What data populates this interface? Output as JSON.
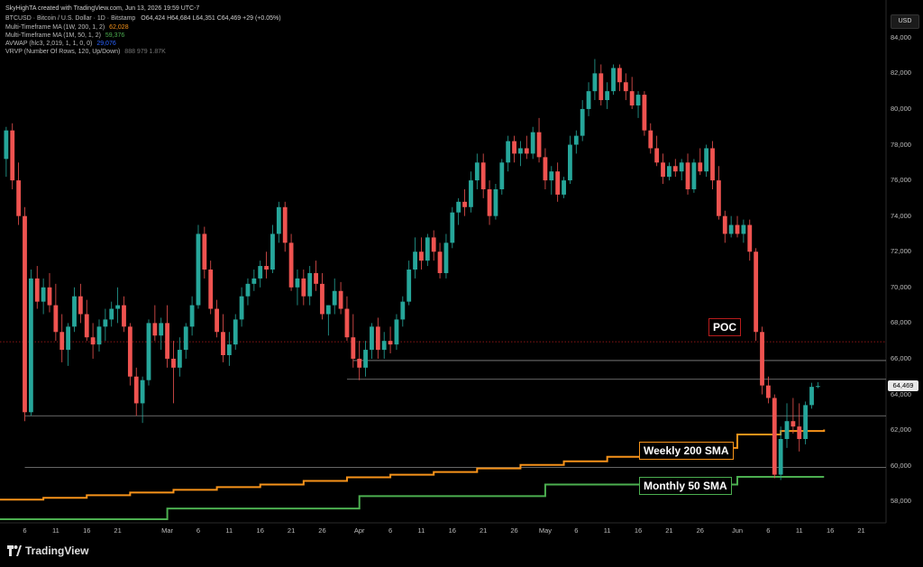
{
  "header": {
    "credit": "SkyHighTA created with TradingView.com, Jun 13, 2026 19:59 UTC-7",
    "symbol_line": "BTCUSD · Bitcoin / U.S. Dollar · 1D · Bitstamp",
    "ohlc": "O64,424 H64,684 L64,351 C64,469 +29 (+0.05%)",
    "indicators": [
      {
        "label": "Multi-Timeframe MA (1W, 200, 1, 2)",
        "value": "62,028",
        "color": "#f7931a"
      },
      {
        "label": "Multi-Timeframe MA (1M, 50, 1, 2)",
        "value": "59,376",
        "color": "#4caf50"
      },
      {
        "label": "AVWAP (hlc3, 2,019, 1, 1, 0, 0)",
        "value": "29,076",
        "color": "#2962ff"
      },
      {
        "label": "VRVP (Number Of Rows, 120, Up/Down)",
        "value": "888  979  1.87K",
        "color": "#888888"
      }
    ]
  },
  "currency_button": "USD",
  "current_price": "64,469",
  "brand": "TradingView",
  "colors": {
    "up": "#26a69a",
    "down": "#ef5350",
    "weekly": "#f7931a",
    "monthly": "#4caf50",
    "poc": "#b71c1c"
  },
  "annotations": {
    "poc": "POC",
    "weekly": "Weekly 200 SMA",
    "monthly": "Monthly 50 SMA"
  },
  "chart_data": {
    "type": "candlestick",
    "title": "BTCUSD · Bitcoin / U.S. Dollar · 1D · Bitstamp",
    "y_ticks": [
      "84,000",
      "82,000",
      "80,000",
      "78,000",
      "76,000",
      "74,000",
      "72,000",
      "70,000",
      "68,000",
      "66,000",
      "64,000",
      "62,000",
      "60,000",
      "58,000"
    ],
    "ylim": [
      56800,
      85000
    ],
    "x_ticks": [
      {
        "label": "6",
        "date": "2026-02-06"
      },
      {
        "label": "11",
        "date": "2026-02-11"
      },
      {
        "label": "16",
        "date": "2026-02-16"
      },
      {
        "label": "21",
        "date": "2026-02-21"
      },
      {
        "label": "Mar",
        "date": "2026-03-01"
      },
      {
        "label": "6",
        "date": "2026-03-06"
      },
      {
        "label": "11",
        "date": "2026-03-11"
      },
      {
        "label": "16",
        "date": "2026-03-16"
      },
      {
        "label": "21",
        "date": "2026-03-21"
      },
      {
        "label": "26",
        "date": "2026-03-26"
      },
      {
        "label": "Apr",
        "date": "2026-04-01"
      },
      {
        "label": "6",
        "date": "2026-04-06"
      },
      {
        "label": "11",
        "date": "2026-04-11"
      },
      {
        "label": "16",
        "date": "2026-04-16"
      },
      {
        "label": "21",
        "date": "2026-04-21"
      },
      {
        "label": "26",
        "date": "2026-04-26"
      },
      {
        "label": "May",
        "date": "2026-05-01"
      },
      {
        "label": "6",
        "date": "2026-05-06"
      },
      {
        "label": "11",
        "date": "2026-05-11"
      },
      {
        "label": "16",
        "date": "2026-05-16"
      },
      {
        "label": "21",
        "date": "2026-05-21"
      },
      {
        "label": "26",
        "date": "2026-05-26"
      },
      {
        "label": "Jun",
        "date": "2026-06-01"
      },
      {
        "label": "6",
        "date": "2026-06-06"
      },
      {
        "label": "11",
        "date": "2026-06-11"
      },
      {
        "label": "16",
        "date": "2026-06-16"
      },
      {
        "label": "21",
        "date": "2026-06-21"
      }
    ],
    "xlim": [
      "2026-02-02",
      "2026-06-25"
    ],
    "candles": [
      [
        "2026-02-03",
        77200,
        79000,
        76200,
        78800
      ],
      [
        "2026-02-04",
        78800,
        79200,
        75500,
        76000
      ],
      [
        "2026-02-05",
        76000,
        77000,
        73500,
        74000
      ],
      [
        "2026-02-06",
        74000,
        74500,
        62500,
        63000
      ],
      [
        "2026-02-07",
        63000,
        71000,
        62800,
        70500
      ],
      [
        "2026-02-08",
        70500,
        71200,
        68800,
        69200
      ],
      [
        "2026-02-09",
        69200,
        70500,
        68500,
        70000
      ],
      [
        "2026-02-10",
        70000,
        70800,
        68600,
        69000
      ],
      [
        "2026-02-11",
        69000,
        70200,
        67000,
        67500
      ],
      [
        "2026-02-12",
        67500,
        68500,
        65800,
        66500
      ],
      [
        "2026-02-13",
        66500,
        68000,
        65600,
        67800
      ],
      [
        "2026-02-14",
        67800,
        70000,
        67500,
        69500
      ],
      [
        "2026-02-15",
        69500,
        70200,
        68000,
        68500
      ],
      [
        "2026-02-16",
        68500,
        69300,
        67000,
        67200
      ],
      [
        "2026-02-17",
        67200,
        68000,
        66000,
        66800
      ],
      [
        "2026-02-18",
        66800,
        68200,
        66400,
        67800
      ],
      [
        "2026-02-19",
        67800,
        68800,
        67000,
        68200
      ],
      [
        "2026-02-20",
        68200,
        69200,
        67800,
        68800
      ],
      [
        "2026-02-21",
        68800,
        70000,
        68000,
        69000
      ],
      [
        "2026-02-22",
        69000,
        69500,
        67500,
        67800
      ],
      [
        "2026-02-23",
        67800,
        68000,
        64500,
        65000
      ],
      [
        "2026-02-24",
        65000,
        65500,
        62800,
        63500
      ],
      [
        "2026-02-25",
        63500,
        65000,
        62400,
        64800
      ],
      [
        "2026-02-26",
        64800,
        68200,
        64500,
        68000
      ],
      [
        "2026-02-27",
        68000,
        69000,
        67000,
        67300
      ],
      [
        "2026-02-28",
        67300,
        68300,
        66500,
        68000
      ],
      [
        "2026-03-01",
        68000,
        69000,
        65500,
        66000
      ],
      [
        "2026-03-02",
        66000,
        67000,
        63500,
        65500
      ],
      [
        "2026-03-03",
        65500,
        67200,
        65000,
        66500
      ],
      [
        "2026-03-04",
        66500,
        68000,
        66000,
        67800
      ],
      [
        "2026-03-05",
        67800,
        69500,
        67300,
        69000
      ],
      [
        "2026-03-06",
        69000,
        73500,
        68800,
        73000
      ],
      [
        "2026-03-07",
        73000,
        73400,
        70500,
        71000
      ],
      [
        "2026-03-08",
        71000,
        71500,
        68500,
        68800
      ],
      [
        "2026-03-09",
        68800,
        69300,
        67200,
        67500
      ],
      [
        "2026-03-10",
        67500,
        68500,
        65800,
        66200
      ],
      [
        "2026-03-11",
        66200,
        67500,
        65600,
        66800
      ],
      [
        "2026-03-12",
        66800,
        68500,
        66500,
        68200
      ],
      [
        "2026-03-13",
        68200,
        70000,
        67800,
        69500
      ],
      [
        "2026-03-14",
        69500,
        70500,
        69000,
        70200
      ],
      [
        "2026-03-15",
        70200,
        71000,
        69800,
        70500
      ],
      [
        "2026-03-16",
        70500,
        71500,
        70000,
        71200
      ],
      [
        "2026-03-17",
        71200,
        72000,
        70500,
        71000
      ],
      [
        "2026-03-18",
        71000,
        73500,
        70800,
        73000
      ],
      [
        "2026-03-19",
        73000,
        74800,
        72500,
        74500
      ],
      [
        "2026-03-20",
        74500,
        74800,
        72000,
        72500
      ],
      [
        "2026-03-21",
        72500,
        73000,
        69800,
        70000
      ],
      [
        "2026-03-22",
        70000,
        71000,
        69000,
        70500
      ],
      [
        "2026-03-23",
        70500,
        71000,
        69000,
        69500
      ],
      [
        "2026-03-24",
        69500,
        71200,
        69000,
        70800
      ],
      [
        "2026-03-25",
        70800,
        71500,
        69800,
        70200
      ],
      [
        "2026-03-26",
        70200,
        70800,
        68200,
        68500
      ],
      [
        "2026-03-27",
        68500,
        69000,
        67300,
        69000
      ],
      [
        "2026-03-28",
        69000,
        70500,
        68500,
        69800
      ],
      [
        "2026-03-29",
        69800,
        70300,
        68500,
        68800
      ],
      [
        "2026-03-30",
        68800,
        69500,
        67000,
        67200
      ],
      [
        "2026-03-31",
        67200,
        68500,
        65500,
        66000
      ],
      [
        "2026-04-01",
        66000,
        67000,
        64800,
        65500
      ],
      [
        "2026-04-02",
        65500,
        67000,
        65000,
        66500
      ],
      [
        "2026-04-03",
        66500,
        68000,
        66000,
        67800
      ],
      [
        "2026-04-04",
        67800,
        68300,
        66000,
        66500
      ],
      [
        "2026-04-05",
        66500,
        67500,
        66000,
        67000
      ],
      [
        "2026-04-06",
        67000,
        67800,
        66300,
        66800
      ],
      [
        "2026-04-07",
        66800,
        68500,
        66500,
        68200
      ],
      [
        "2026-04-08",
        68200,
        69500,
        67800,
        69200
      ],
      [
        "2026-04-09",
        69200,
        71500,
        69000,
        71000
      ],
      [
        "2026-04-10",
        71000,
        72800,
        70500,
        72000
      ],
      [
        "2026-04-11",
        72000,
        72800,
        71000,
        71500
      ],
      [
        "2026-04-12",
        71500,
        73000,
        71200,
        72800
      ],
      [
        "2026-04-13",
        72800,
        73200,
        71500,
        72000
      ],
      [
        "2026-04-14",
        72000,
        72500,
        70500,
        70800
      ],
      [
        "2026-04-15",
        70800,
        73000,
        70500,
        72500
      ],
      [
        "2026-04-16",
        72500,
        74500,
        72200,
        74200
      ],
      [
        "2026-04-17",
        74200,
        75000,
        73500,
        74800
      ],
      [
        "2026-04-18",
        74800,
        75500,
        74000,
        74500
      ],
      [
        "2026-04-19",
        74500,
        76500,
        74200,
        76000
      ],
      [
        "2026-04-20",
        76000,
        77500,
        75500,
        77000
      ],
      [
        "2026-04-21",
        77000,
        77500,
        75000,
        75500
      ],
      [
        "2026-04-22",
        75500,
        76000,
        73500,
        74000
      ],
      [
        "2026-04-23",
        74000,
        75800,
        73800,
        75500
      ],
      [
        "2026-04-24",
        75500,
        77200,
        75200,
        77000
      ],
      [
        "2026-04-25",
        77000,
        78500,
        76500,
        78200
      ],
      [
        "2026-04-26",
        78200,
        78500,
        77000,
        77500
      ],
      [
        "2026-04-27",
        77500,
        78200,
        76800,
        77800
      ],
      [
        "2026-04-28",
        77800,
        78500,
        77200,
        77500
      ],
      [
        "2026-04-29",
        77500,
        79000,
        77200,
        78700
      ],
      [
        "2026-04-30",
        78700,
        79500,
        77000,
        77300
      ],
      [
        "2026-05-01",
        77300,
        77800,
        75500,
        76000
      ],
      [
        "2026-05-02",
        76000,
        76800,
        75200,
        76500
      ],
      [
        "2026-05-03",
        76500,
        77000,
        74800,
        75200
      ],
      [
        "2026-05-04",
        75200,
        76200,
        75000,
        76000
      ],
      [
        "2026-05-05",
        76000,
        78500,
        75800,
        78000
      ],
      [
        "2026-05-06",
        78000,
        78800,
        77500,
        78500
      ],
      [
        "2026-05-07",
        78500,
        80500,
        78200,
        80000
      ],
      [
        "2026-05-08",
        80000,
        81500,
        79600,
        81000
      ],
      [
        "2026-05-09",
        81000,
        82800,
        80500,
        82000
      ],
      [
        "2026-05-10",
        82000,
        82500,
        80200,
        80500
      ],
      [
        "2026-05-11",
        80500,
        81500,
        80000,
        81000
      ],
      [
        "2026-05-12",
        81000,
        82500,
        80800,
        82300
      ],
      [
        "2026-05-13",
        82300,
        82500,
        81000,
        81500
      ],
      [
        "2026-05-14",
        81500,
        82000,
        80500,
        81000
      ],
      [
        "2026-05-15",
        81000,
        81800,
        80000,
        80200
      ],
      [
        "2026-05-16",
        80200,
        81000,
        79500,
        80800
      ],
      [
        "2026-05-17",
        80800,
        81000,
        78500,
        78800
      ],
      [
        "2026-05-18",
        78800,
        79200,
        77500,
        77800
      ],
      [
        "2026-05-19",
        77800,
        78500,
        76800,
        77000
      ],
      [
        "2026-05-20",
        77000,
        77500,
        75800,
        76200
      ],
      [
        "2026-05-21",
        76200,
        77000,
        76000,
        76800
      ],
      [
        "2026-05-22",
        76800,
        77200,
        76200,
        76500
      ],
      [
        "2026-05-23",
        76500,
        77200,
        76000,
        77000
      ],
      [
        "2026-05-24",
        77000,
        77500,
        75200,
        75500
      ],
      [
        "2026-05-25",
        75500,
        77200,
        75300,
        77000
      ],
      [
        "2026-05-26",
        77000,
        77800,
        76300,
        76500
      ],
      [
        "2026-05-27",
        76500,
        78000,
        76200,
        77800
      ],
      [
        "2026-05-28",
        77800,
        78200,
        75500,
        76000
      ],
      [
        "2026-05-29",
        76000,
        76800,
        73800,
        74000
      ],
      [
        "2026-05-30",
        74000,
        74300,
        72500,
        73000
      ],
      [
        "2026-05-31",
        73000,
        74000,
        72800,
        73500
      ],
      [
        "2026-06-01",
        73500,
        74000,
        72800,
        73000
      ],
      [
        "2026-06-02",
        73000,
        73800,
        72500,
        73500
      ],
      [
        "2026-06-03",
        73500,
        73800,
        71500,
        72000
      ],
      [
        "2026-06-04",
        72000,
        72200,
        67000,
        67500
      ],
      [
        "2026-06-05",
        67500,
        67800,
        64000,
        64500
      ],
      [
        "2026-06-06",
        64500,
        65000,
        63500,
        63800
      ],
      [
        "2026-06-07",
        63800,
        64000,
        59300,
        59500
      ],
      [
        "2026-06-08",
        59500,
        62200,
        59200,
        61500
      ],
      [
        "2026-06-09",
        61500,
        63500,
        61000,
        62500
      ],
      [
        "2026-06-10",
        62500,
        63800,
        61800,
        62200
      ],
      [
        "2026-06-11",
        62200,
        63500,
        60800,
        61500
      ],
      [
        "2026-06-12",
        61500,
        63600,
        61200,
        63400
      ],
      [
        "2026-06-13",
        63400,
        64650,
        63200,
        64424
      ],
      [
        "2026-06-14",
        64424,
        64684,
        64351,
        64469
      ]
    ],
    "series": [
      {
        "name": "Weekly 200 SMA",
        "color": "#f7931a",
        "points": [
          [
            "2026-02-02",
            58100
          ],
          [
            "2026-02-09",
            58200
          ],
          [
            "2026-02-16",
            58350
          ],
          [
            "2026-02-23",
            58500
          ],
          [
            "2026-03-02",
            58650
          ],
          [
            "2026-03-09",
            58800
          ],
          [
            "2026-03-16",
            58950
          ],
          [
            "2026-03-23",
            59150
          ],
          [
            "2026-03-30",
            59350
          ],
          [
            "2026-04-06",
            59500
          ],
          [
            "2026-04-13",
            59650
          ],
          [
            "2026-04-20",
            59850
          ],
          [
            "2026-04-27",
            60050
          ],
          [
            "2026-05-04",
            60250
          ],
          [
            "2026-05-11",
            60500
          ],
          [
            "2026-05-18",
            60750
          ],
          [
            "2026-05-25",
            61000
          ],
          [
            "2026-06-01",
            61750
          ],
          [
            "2026-06-08",
            61950
          ],
          [
            "2026-06-15",
            62028
          ]
        ]
      },
      {
        "name": "Monthly 50 SMA",
        "color": "#4caf50",
        "points": [
          [
            "2026-02-02",
            57000
          ],
          [
            "2026-03-01",
            57600
          ],
          [
            "2026-04-01",
            58300
          ],
          [
            "2026-05-01",
            58950
          ],
          [
            "2026-06-01",
            59376
          ],
          [
            "2026-06-15",
            59376
          ]
        ]
      }
    ],
    "horizontal_lines": [
      {
        "value": 66950,
        "style": "dotted",
        "color": "#b71c1c",
        "from": "2026-02-02",
        "to": "2026-06-25"
      },
      {
        "value": 65900,
        "color": "#888888",
        "from": "2026-03-31",
        "to": "2026-06-25"
      },
      {
        "value": 64850,
        "color": "#888888",
        "from": "2026-03-30",
        "to": "2026-06-25"
      },
      {
        "value": 62800,
        "color": "#888888",
        "from": "2026-02-06",
        "to": "2026-06-25"
      },
      {
        "value": 59900,
        "color": "#888888",
        "from": "2026-02-06",
        "to": "2026-06-25"
      }
    ]
  }
}
